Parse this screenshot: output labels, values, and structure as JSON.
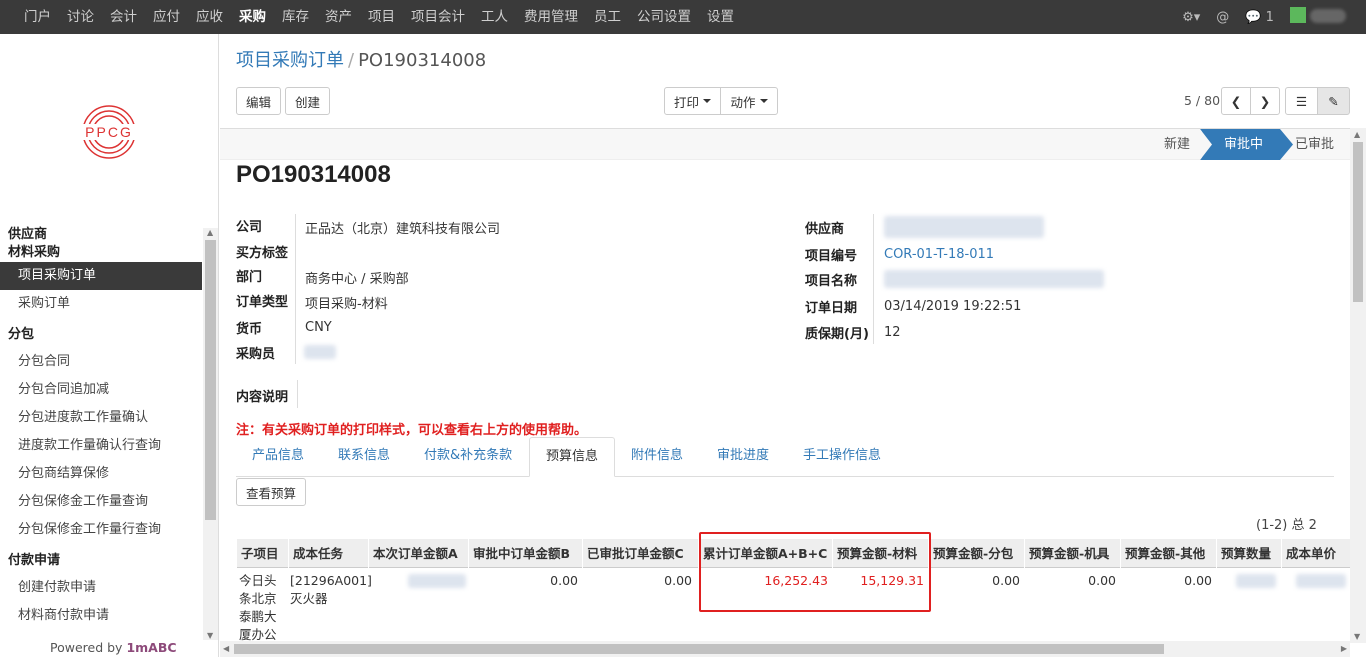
{
  "nav": {
    "menu": [
      "门户",
      "讨论",
      "会计",
      "应付",
      "应收",
      "采购",
      "库存",
      "资产",
      "项目",
      "项目会计",
      "工人",
      "费用管理",
      "员工",
      "公司设置",
      "设置"
    ],
    "active": "采购",
    "gear_icon": "gear-icon",
    "at_icon": "at-icon",
    "chat_icon": "chat-icon",
    "chat_count": "1"
  },
  "logo": {
    "text": "PPCG"
  },
  "sidebar": {
    "items": [
      {
        "label": "供应商",
        "kind": "grp"
      },
      {
        "label": "材料采购",
        "kind": "grp"
      },
      {
        "label": "项目采购订单",
        "kind": "item",
        "active": true
      },
      {
        "label": "采购订单",
        "kind": "item"
      },
      {
        "label": "分包",
        "kind": "grp"
      },
      {
        "label": "分包合同",
        "kind": "item"
      },
      {
        "label": "分包合同追加减",
        "kind": "item"
      },
      {
        "label": "分包进度款工作量确认",
        "kind": "item"
      },
      {
        "label": "进度款工作量确认行查询",
        "kind": "item"
      },
      {
        "label": "分包商结算保修",
        "kind": "item"
      },
      {
        "label": "分包保修金工作量查询",
        "kind": "item"
      },
      {
        "label": "分包保修金工作量行查询",
        "kind": "item"
      },
      {
        "label": "付款申请",
        "kind": "grp"
      },
      {
        "label": "创建付款申请",
        "kind": "item"
      },
      {
        "label": "材料商付款申请",
        "kind": "item"
      }
    ],
    "powered_prefix": "Powered by ",
    "powered_brand": "1mABC"
  },
  "header": {
    "breadcrumb_parent": "项目采购订单",
    "breadcrumb_sep": "/",
    "breadcrumb_current": "PO190314008",
    "edit_label": "编辑",
    "create_label": "创建",
    "print_label": "打印",
    "action_label": "动作",
    "pager": "5 / 80"
  },
  "status": {
    "stages": [
      "新建",
      "审批中",
      "已审批"
    ],
    "active": "审批中"
  },
  "form": {
    "title": "PO190314008",
    "left": [
      {
        "label": "公司",
        "value": "正品达（北京）建筑科技有限公司"
      },
      {
        "label": "买方标签",
        "value": ""
      },
      {
        "label": "部门",
        "value": "商务中心 / 采购部"
      },
      {
        "label": "订单类型",
        "value": "项目采购-材料"
      },
      {
        "label": "货币",
        "value": "CNY"
      },
      {
        "label": "采购员",
        "value": ""
      }
    ],
    "right": [
      {
        "label": "供应商",
        "value": ""
      },
      {
        "label": "项目编号",
        "value": "COR-01-T-18-011"
      },
      {
        "label": "项目名称",
        "value": ""
      },
      {
        "label": "订单日期",
        "value": "03/14/2019 19:22:51"
      },
      {
        "label": "质保期(月)",
        "value": "12"
      }
    ],
    "content_label": "内容说明",
    "note": "注：有关采购订单的打印样式，可以查看右上方的使用帮助。"
  },
  "tabs": {
    "items": [
      "产品信息",
      "联系信息",
      "付款&补充条款",
      "预算信息",
      "附件信息",
      "审批进度",
      "手工操作信息"
    ],
    "active": "预算信息"
  },
  "budget": {
    "view_button": "查看预算",
    "count": "(1-2) 总 2",
    "columns": [
      "子项目",
      "成本任务",
      "本次订单金额A",
      "审批中订单金额B",
      "已审批订单金额C",
      "累计订单金额A+B+C",
      "预算金额-材料",
      "预算金额-分包",
      "预算金额-机具",
      "预算金额-其他",
      "预算数量",
      "成本单价"
    ],
    "row": {
      "subproject": "今日头条北京泰鹏大厦办公",
      "subproject_lines": [
        "今日头",
        "条北京",
        "泰鹏大",
        "厦办公"
      ],
      "task_lines": [
        "[21296A001]",
        "灭火器"
      ],
      "amount_a": "",
      "amount_b": "0.00",
      "amount_c": "0.00",
      "cumulative": "16,252.43",
      "budget_material": "15,129.31",
      "budget_sub": "0.00",
      "budget_equipment": "0.00",
      "budget_other": "0.00",
      "budget_qty": "",
      "unit_cost": ""
    }
  },
  "colors": {
    "accent": "#337ab7",
    "topbar": "#3a3a3a",
    "alert": "#e02020"
  }
}
